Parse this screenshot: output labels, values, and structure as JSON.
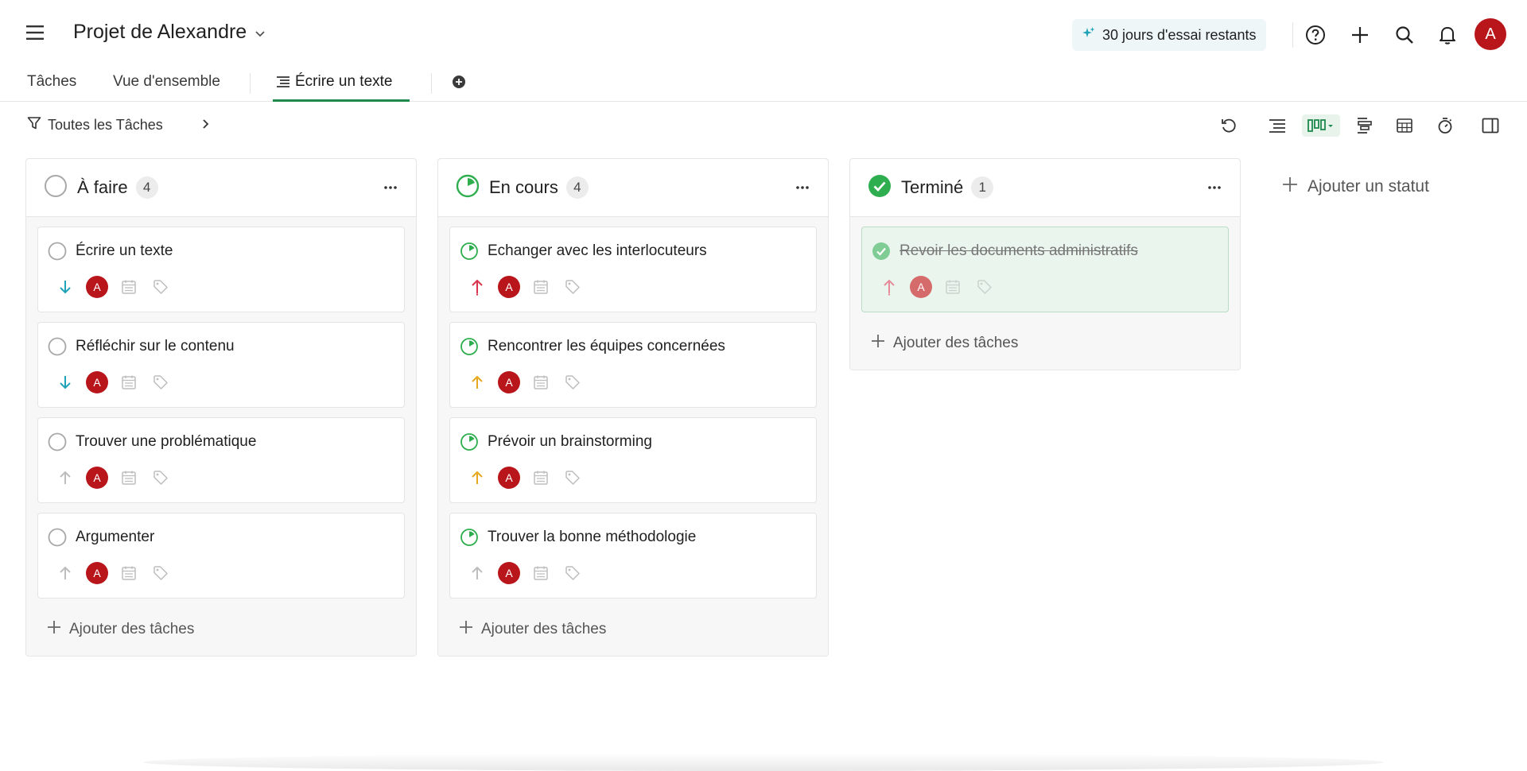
{
  "header": {
    "project_title": "Projet de Alexandre",
    "trial_text": "30 jours d'essai restants",
    "avatar_initial": "A"
  },
  "tabs": [
    {
      "label": "Tâches"
    },
    {
      "label": "Vue d'ensemble"
    },
    {
      "label": "Écrire un texte"
    }
  ],
  "toolbar": {
    "filter_label": "Toutes les Tâches"
  },
  "columns": [
    {
      "title": "À faire",
      "count": "4",
      "add_label": "Ajouter des tâches",
      "cards": [
        {
          "title": "Écrire un texte",
          "avatar": "A"
        },
        {
          "title": "Réfléchir sur le contenu",
          "avatar": "A"
        },
        {
          "title": "Trouver une problématique",
          "avatar": "A"
        },
        {
          "title": "Argumenter",
          "avatar": "A"
        }
      ]
    },
    {
      "title": "En cours",
      "count": "4",
      "add_label": "Ajouter des tâches",
      "cards": [
        {
          "title": "Echanger avec les interlocuteurs",
          "avatar": "A"
        },
        {
          "title": "Rencontrer les équipes concernées",
          "avatar": "A"
        },
        {
          "title": "Prévoir un brainstorming",
          "avatar": "A"
        },
        {
          "title": "Trouver la bonne méthodologie",
          "avatar": "A"
        }
      ]
    },
    {
      "title": "Terminé",
      "count": "1",
      "add_label": "Ajouter des tâches",
      "cards": [
        {
          "title": "Revoir les documents administratifs",
          "avatar": "A"
        }
      ]
    }
  ],
  "add_status_label": "Ajouter un statut",
  "colors": {
    "accent_green": "#1e8a4c",
    "done_green": "#2eae4e",
    "avatar_red": "#b8161b",
    "priority_low": "#1fa3b8",
    "priority_high": "#d9344d",
    "priority_medium": "#e7a81f",
    "priority_none": "#bdbdbd"
  }
}
